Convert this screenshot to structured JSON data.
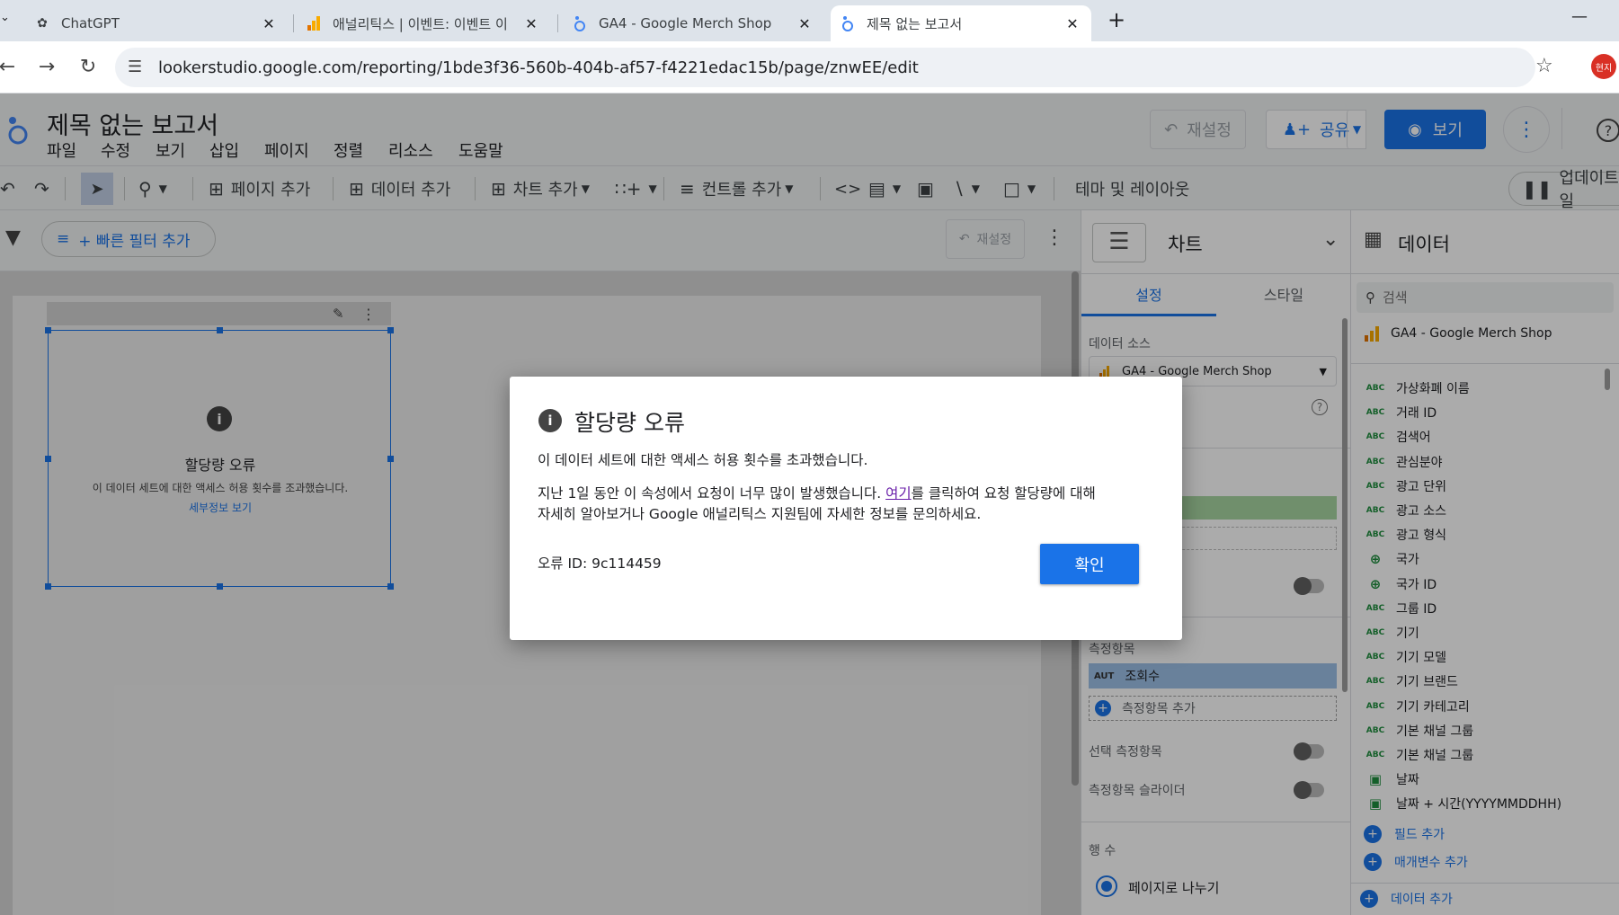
{
  "browser": {
    "tabs": [
      {
        "title": "ChatGPT",
        "icon": "chatgpt-icon"
      },
      {
        "title": "애널리틱스 | 이벤트: 이벤트 이",
        "icon": "analytics-icon"
      },
      {
        "title": "GA4 - Google Merch Shop",
        "icon": "looker-icon"
      },
      {
        "title": "제목 없는 보고서",
        "icon": "looker-icon"
      }
    ],
    "url": "lookerstudio.google.com/reporting/1bde3f36-560b-404b-af57-f4221edac15b/page/znwEE/edit",
    "profile": "현지"
  },
  "app": {
    "title": "제목 없는 보고서",
    "menus": [
      "파일",
      "수정",
      "보기",
      "삽입",
      "페이지",
      "정렬",
      "리소스",
      "도움말"
    ],
    "reset_label": "재설정",
    "share_label": "공유",
    "view_label": "보기",
    "help": "?"
  },
  "toolbar": {
    "add_page": "페이지 추가",
    "add_data": "데이터 추가",
    "add_chart": "차트 추가",
    "add_control": "컨트롤 추가",
    "theme_layout": "테마 및 레이아웃",
    "update": "업데이트 일"
  },
  "filterbar": {
    "quick_filter": "+ 빠른 필터 추가",
    "reset": "재설정"
  },
  "widget": {
    "title": "할당량 오류",
    "message": "이 데이터 세트에 대한 액세스 허용 횟수를 조과했습니다.",
    "link": "세부정보 보기"
  },
  "props": {
    "header": "차트",
    "tab_setup": "설정",
    "tab_style": "스타일",
    "data_source_label": "데이터 소스",
    "data_source": "GA4 - Google Merch Shop",
    "metric_label": "측정항목",
    "metric_type": "AUT",
    "metric": "조회수",
    "add_metric": "측정항목 추가",
    "optional_metric": "선택 측정항목",
    "metric_slider": "측정항목 슬라이더",
    "rows_label": "행 수",
    "paginate": "페이지로 나누기"
  },
  "data_panel": {
    "header": "데이터",
    "search_placeholder": "검색",
    "source": "GA4 - Google Merch Shop",
    "fields": [
      {
        "type": "ABC",
        "name": "가상화폐 이름"
      },
      {
        "type": "ABC",
        "name": "거래 ID"
      },
      {
        "type": "ABC",
        "name": "검색어"
      },
      {
        "type": "ABC",
        "name": "관심분야"
      },
      {
        "type": "ABC",
        "name": "광고 단위"
      },
      {
        "type": "ABC",
        "name": "광고 소스"
      },
      {
        "type": "ABC",
        "name": "광고 형식"
      },
      {
        "type": "geo",
        "name": "국가"
      },
      {
        "type": "geo",
        "name": "국가 ID"
      },
      {
        "type": "ABC",
        "name": "그룹 ID"
      },
      {
        "type": "ABC",
        "name": "기기"
      },
      {
        "type": "ABC",
        "name": "기기 모델"
      },
      {
        "type": "ABC",
        "name": "기기 브랜드"
      },
      {
        "type": "ABC",
        "name": "기기 카테고리"
      },
      {
        "type": "ABC",
        "name": "기본 채널 그룹"
      },
      {
        "type": "ABC",
        "name": "기본 채널 그룹"
      },
      {
        "type": "date",
        "name": "날짜"
      },
      {
        "type": "date",
        "name": "날짜 + 시간(YYYYMMDDHH)"
      }
    ],
    "add_field": "필드 추가",
    "add_param": "매개변수 추가",
    "add_data": "데이터 추가"
  },
  "dialog": {
    "title": "할당량 오류",
    "line1": "이 데이터 세트에 대한 액세스 허용 횟수를 초과했습니다.",
    "line2_pre": "지난 1일 동안 이 속성에서 요청이 너무 많이 발생했습니다. ",
    "line2_link": "여기",
    "line2_post": "를 클릭하여 요청 할당량에 대해",
    "line3": "자세히 알아보거나 Google 애널리틱스 지원팀에 자세한 정보를 문의하세요.",
    "error_id": "오류 ID: 9c114459",
    "ok": "확인"
  },
  "colors": {
    "accent": "#1a73e8",
    "link": "#1a73e8"
  }
}
